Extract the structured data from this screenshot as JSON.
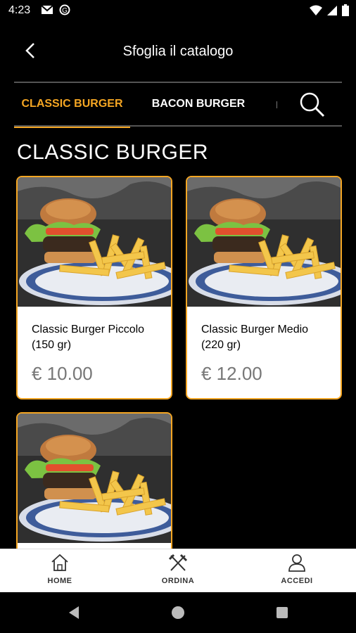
{
  "status_bar": {
    "time": "4:23"
  },
  "header": {
    "title": "Sfoglia il catalogo"
  },
  "tabs": [
    {
      "label": "CLASSIC BURGER",
      "active": true
    },
    {
      "label": "BACON BURGER",
      "active": false
    }
  ],
  "section": {
    "title": "CLASSIC BURGER"
  },
  "products": [
    {
      "name": "Classic Burger Piccolo (150 gr)",
      "price": "€ 10.00"
    },
    {
      "name": "Classic Burger Medio (220 gr)",
      "price": "€ 12.00"
    },
    {
      "name": "",
      "price": ""
    }
  ],
  "bottom_nav": [
    {
      "label": "HOME",
      "icon": "home-icon"
    },
    {
      "label": "ORDINA",
      "icon": "cutlery-icon"
    },
    {
      "label": "ACCEDI",
      "icon": "user-icon"
    }
  ],
  "colors": {
    "accent": "#f5a623",
    "background": "#000000",
    "card": "#ffffff",
    "price": "#777777"
  }
}
